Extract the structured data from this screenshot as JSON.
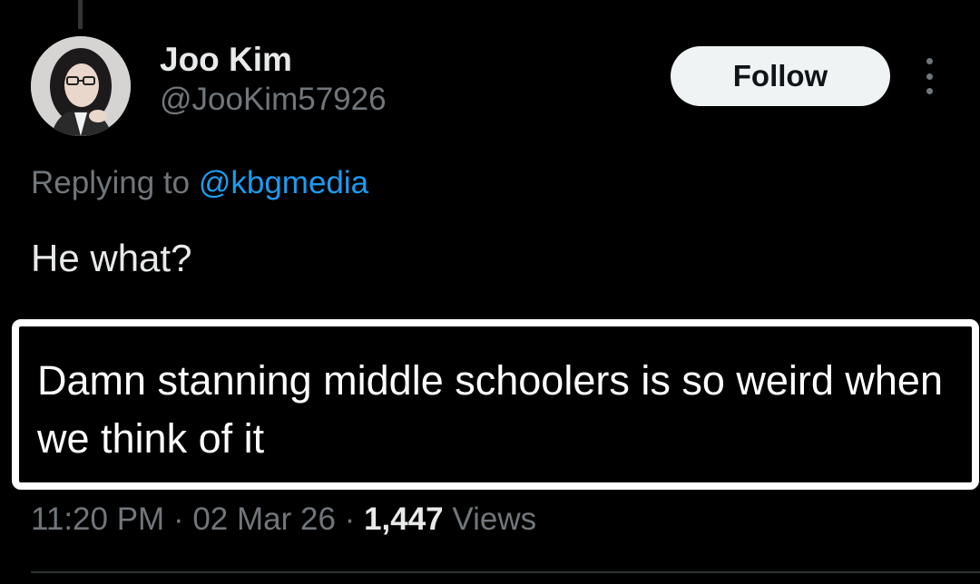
{
  "author": {
    "display_name": "Joo Kim",
    "handle": "@JooKim57926",
    "avatar": "profile-photo"
  },
  "follow_label": "Follow",
  "more_icon": "more-options-icon",
  "reply_context": {
    "prefix": "Replying to",
    "mention": "@kbgmedia"
  },
  "tweet_text": "He what?",
  "quoted_text": "Damn stanning middle schoolers is so weird when we think of it",
  "meta": {
    "time": "11:20 PM",
    "separator": "·",
    "date": "02 Mar 26",
    "views_count": "1,447",
    "views_label": "Views"
  },
  "colors": {
    "background": "#000000",
    "primary_text": "#e7e9ea",
    "secondary_text": "#71767b",
    "link": "#1d9bf0",
    "follow_bg": "#eff3f4"
  }
}
